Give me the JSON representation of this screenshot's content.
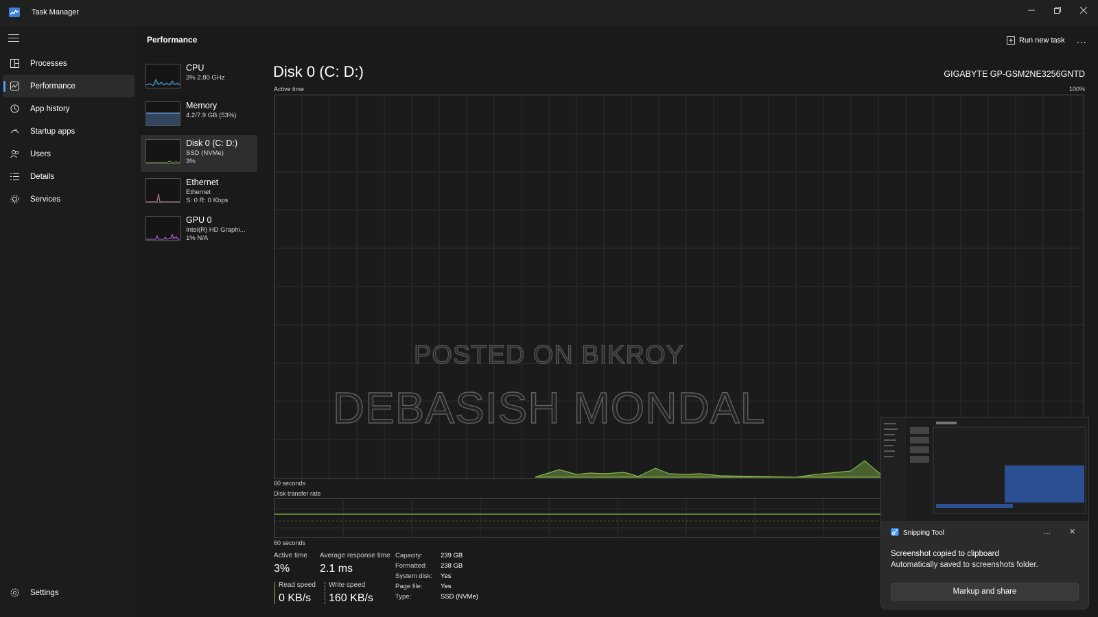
{
  "window": {
    "title": "Task Manager"
  },
  "nav": {
    "items": [
      {
        "label": "Processes",
        "icon": "processes-icon",
        "active": false
      },
      {
        "label": "Performance",
        "icon": "performance-icon",
        "active": true
      },
      {
        "label": "App history",
        "icon": "history-icon",
        "active": false
      },
      {
        "label": "Startup apps",
        "icon": "startup-icon",
        "active": false
      },
      {
        "label": "Users",
        "icon": "users-icon",
        "active": false
      },
      {
        "label": "Details",
        "icon": "details-icon",
        "active": false
      },
      {
        "label": "Services",
        "icon": "services-icon",
        "active": false
      }
    ],
    "settings_label": "Settings"
  },
  "header": {
    "title": "Performance",
    "run_new_task_label": "Run new task",
    "more_label": "..."
  },
  "perf_items": [
    {
      "name": "CPU",
      "line1": "3% 2.80 GHz",
      "line2": "",
      "color": "#4aa3df"
    },
    {
      "name": "Memory",
      "line1": "4.2/7.9 GB (53%)",
      "line2": "",
      "color": "#6aa0e8"
    },
    {
      "name": "Disk 0 (C: D:)",
      "line1": "SSD (NVMe)",
      "line2": "3%",
      "color": "#86b84a"
    },
    {
      "name": "Ethernet",
      "line1": "Ethernet",
      "line2": "S: 0 R: 0 Kbps",
      "color": "#d1868a"
    },
    {
      "name": "GPU 0",
      "line1": "Intel(R) HD Graphi...",
      "line2": "1% N/A",
      "color": "#b264d8"
    }
  ],
  "disk": {
    "title": "Disk 0 (C: D:)",
    "model": "GIGABYTE GP-GSM2NE3256GNTD",
    "active_time_label": "Active time",
    "max_label": "100%",
    "seconds_label": "60 seconds",
    "transfer_label": "Disk transfer rate",
    "transfer_seconds_label": "60 seconds",
    "accent": "#86b84a"
  },
  "watermark": {
    "line1": "POSTED ON BIKROY",
    "line2": "DEBASISH MONDAL"
  },
  "stats": {
    "active_time": {
      "label": "Active time",
      "value": "3%"
    },
    "avg_response": {
      "label": "Average response time",
      "value": "2.1 ms"
    },
    "read_speed": {
      "label": "Read speed",
      "value": "0 KB/s"
    },
    "write_speed": {
      "label": "Write speed",
      "value": "160 KB/s"
    }
  },
  "info": [
    {
      "label": "Capacity:",
      "value": "239 GB"
    },
    {
      "label": "Formatted:",
      "value": "238 GB"
    },
    {
      "label": "System disk:",
      "value": "Yes"
    },
    {
      "label": "Page file:",
      "value": "Yes"
    },
    {
      "label": "Type:",
      "value": "SSD (NVMe)"
    }
  ],
  "toast": {
    "app_name": "Snipping Tool",
    "heading": "Screenshot copied to clipboard",
    "body": "Automatically saved to screenshots folder.",
    "button_label": "Markup and share",
    "more_label": "...",
    "close_label": "✕"
  }
}
